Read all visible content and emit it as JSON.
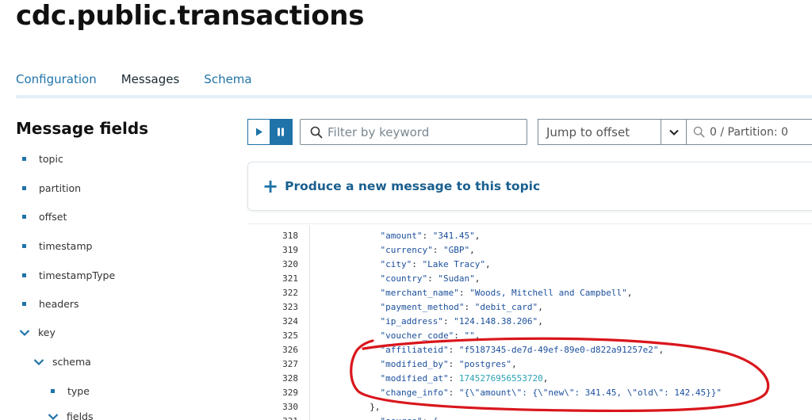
{
  "page": {
    "title": "cdc.public.transactions"
  },
  "tabs": [
    {
      "label": "Configuration",
      "active": false
    },
    {
      "label": "Messages",
      "active": true
    },
    {
      "label": "Schema",
      "active": false
    }
  ],
  "sidebar": {
    "title": "Message fields",
    "items": [
      {
        "label": "topic"
      },
      {
        "label": "partition"
      },
      {
        "label": "offset"
      },
      {
        "label": "timestamp"
      },
      {
        "label": "timestampType"
      },
      {
        "label": "headers"
      },
      {
        "label": "key",
        "expanded": true
      },
      {
        "label": "schema",
        "expanded": true
      },
      {
        "label": "type"
      },
      {
        "label": "fields",
        "expanded": true
      }
    ]
  },
  "toolbar": {
    "play_icon": "play-icon",
    "pause_icon": "pause-icon",
    "filter_placeholder": "Filter by keyword",
    "jump_label": "Jump to offset",
    "partition_text": "0 / Partition: 0"
  },
  "produce": {
    "plus": "+",
    "label": "Produce a new message to this topic"
  },
  "code": {
    "lines": [
      {
        "no": "318",
        "key": "\"amount\"",
        "val": "\"341.45\"",
        "tail": ","
      },
      {
        "no": "319",
        "key": "\"currency\"",
        "val": "\"GBP\"",
        "tail": ","
      },
      {
        "no": "320",
        "key": "\"city\"",
        "val": "\"Lake Tracy\"",
        "tail": ","
      },
      {
        "no": "321",
        "key": "\"country\"",
        "val": "\"Sudan\"",
        "tail": ","
      },
      {
        "no": "322",
        "key": "\"merchant_name\"",
        "val": "\"Woods, Mitchell and Campbell\"",
        "tail": ","
      },
      {
        "no": "323",
        "key": "\"payment_method\"",
        "val": "\"debit_card\"",
        "tail": ","
      },
      {
        "no": "324",
        "key": "\"ip_address\"",
        "val": "\"124.148.38.206\"",
        "tail": ","
      },
      {
        "no": "325",
        "key": "\"voucher_code\"",
        "val": "\"\"",
        "tail": ","
      },
      {
        "no": "326",
        "key": "\"affiliateid\"",
        "val": "\"f5187345-de7d-49ef-89e0-d822a91257e2\"",
        "tail": ","
      },
      {
        "no": "327",
        "key": "\"modified_by\"",
        "val": "\"postgres\"",
        "tail": ","
      },
      {
        "no": "328",
        "key": "\"modified_at\"",
        "val": "1745276956553720",
        "tail": ",",
        "numeric": true
      },
      {
        "no": "329",
        "key": "\"change_info\"",
        "val": "\"{\\\"amount\\\": {\\\"new\\\": 341.45, \\\"old\\\": 142.45}}\"",
        "tail": ""
      },
      {
        "no": "330",
        "key": "",
        "val": "},",
        "tail": ""
      },
      {
        "no": "331",
        "key": "\"source\"",
        "val": "{",
        "tail": ""
      }
    ]
  },
  "colors": {
    "accent": "#1f73a8",
    "annotation": "#d9161c"
  }
}
